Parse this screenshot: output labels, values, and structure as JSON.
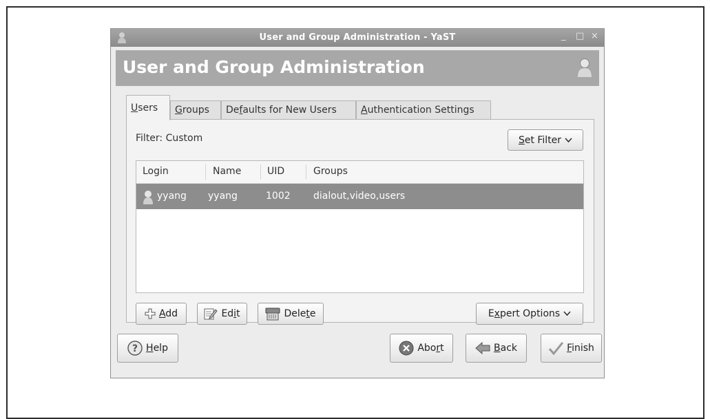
{
  "window": {
    "title": "User and Group Administration - YaST",
    "minimize": "_",
    "maximize": "□",
    "close": "×"
  },
  "banner": {
    "title": "User and Group Administration"
  },
  "tabs": [
    {
      "pre": "",
      "ul": "U",
      "post": "sers"
    },
    {
      "pre": "",
      "ul": "G",
      "post": "roups"
    },
    {
      "pre": "De",
      "ul": "f",
      "post": "aults for New Users"
    },
    {
      "pre": "",
      "ul": "A",
      "post": "uthentication Settings"
    }
  ],
  "filter": {
    "label": "Filter:",
    "value": "Custom"
  },
  "set_filter": {
    "pre": "",
    "ul": "S",
    "post": "et Filter"
  },
  "table": {
    "headers": [
      "Login",
      "Name",
      "UID",
      "Groups"
    ],
    "rows": [
      {
        "login": "yyang",
        "name": "yyang",
        "uid": "1002",
        "groups": "dialout,video,users"
      }
    ]
  },
  "buttons": {
    "add": {
      "pre": "",
      "ul": "A",
      "post": "dd"
    },
    "edit": {
      "pre": "Ed",
      "ul": "i",
      "post": "t"
    },
    "delete": {
      "pre": "Dele",
      "ul": "t",
      "post": "e"
    },
    "expert": {
      "pre": "E",
      "ul": "x",
      "post": "pert Options"
    },
    "help": {
      "pre": "",
      "ul": "H",
      "post": "elp"
    },
    "abort": {
      "pre": "Abo",
      "ul": "r",
      "post": "t"
    },
    "back": {
      "pre": "",
      "ul": "B",
      "post": "ack"
    },
    "finish": {
      "pre": "",
      "ul": "F",
      "post": "inish"
    }
  },
  "icons": {
    "app": "yast-user-icon",
    "banner": "user-icon",
    "add": "plus-icon",
    "edit": "edit-icon",
    "delete": "delete-icon",
    "expert": "chevron-down-icon",
    "help": "help-icon",
    "abort": "abort-icon",
    "back": "back-arrow-icon",
    "finish": "checkmark-icon"
  },
  "colors": {
    "banner": "#a8a8a8",
    "selected_row": "#8d8d8d",
    "titlebar": "#8a8a8a"
  }
}
